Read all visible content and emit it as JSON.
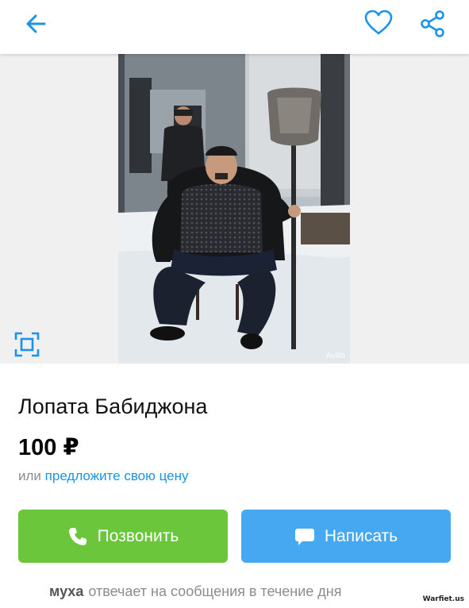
{
  "listing": {
    "title": "Лопата Бабиджона",
    "price": "100 ₽",
    "offer_prefix": "или",
    "offer_link": "предложите свою цену"
  },
  "photo": {
    "watermark": "Avito"
  },
  "actions": {
    "call_label": "Позвонить",
    "message_label": "Написать"
  },
  "seller": {
    "name": "муха",
    "reply_text": "отвечает на сообщения в течение дня"
  },
  "footer": {
    "site_mark": "Warfiet.us"
  },
  "icons": {
    "back": "arrow-left-icon",
    "favorite": "heart-icon",
    "share": "share-icon",
    "fullscreen": "fullscreen-icon",
    "phone": "phone-icon",
    "chat": "chat-bubble-icon"
  },
  "colors": {
    "accent": "#1a93e8",
    "call_button": "#6cc63c",
    "message_button": "#46a8f0"
  }
}
